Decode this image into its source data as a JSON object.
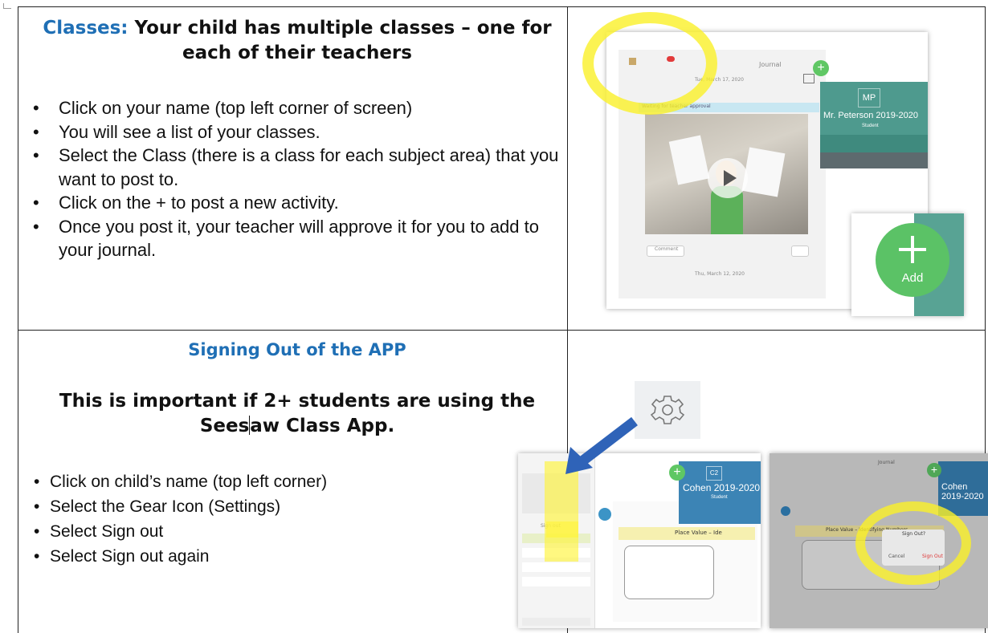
{
  "section1": {
    "title_prefix": "Classes:",
    "title_rest": " Your child has multiple classes – one for each of their teachers",
    "bullets": [
      "Click on your name (top left corner of screen)",
      "You will see a list of your classes.",
      "Select the Class (there is a class for each subject area) that you want to post to.",
      "Click on the + to post a new activity.",
      "Once you post it, your teacher will approve it for you to add to your journal."
    ]
  },
  "section2": {
    "title": "Signing Out of the APP",
    "subtitle_part1": "This is important if 2+ students are using the Sees",
    "subtitle_part2": "aw Class App.",
    "bullets": [
      "Click on child’s name (top left corner)",
      "Select the Gear Icon (Settings)",
      "Select Sign out",
      "Select Sign out again"
    ]
  },
  "screenshot1": {
    "header": "Journal",
    "date1": "Tue, March 17, 2020",
    "date2": "Thu, March 12, 2020",
    "status": "Waiting for teacher approval",
    "avatar_initials": "MP",
    "class_name": "Mr. Peterson 2019-2020",
    "class_role": "Student",
    "add_label": "Add",
    "comment_label": "Comment"
  },
  "screenshot2": {
    "class_name": "Cohen 2019-2020",
    "class_role": "Student",
    "avatar_initials": "C2",
    "title": "Place Value – Ide",
    "sign_out": "Sign out"
  },
  "screenshot3": {
    "class_name": "Cohen 2019-2020",
    "header": "Journal",
    "title": "Place Value – Identifying Numbers",
    "dialog_title": "Sign Out?",
    "cancel": "Cancel",
    "sign_out": "Sign Out"
  },
  "colors": {
    "accent_blue": "#1f6fb5",
    "teal": "#4e9a8e",
    "green": "#5fc764",
    "highlight": "#f5ea28"
  }
}
